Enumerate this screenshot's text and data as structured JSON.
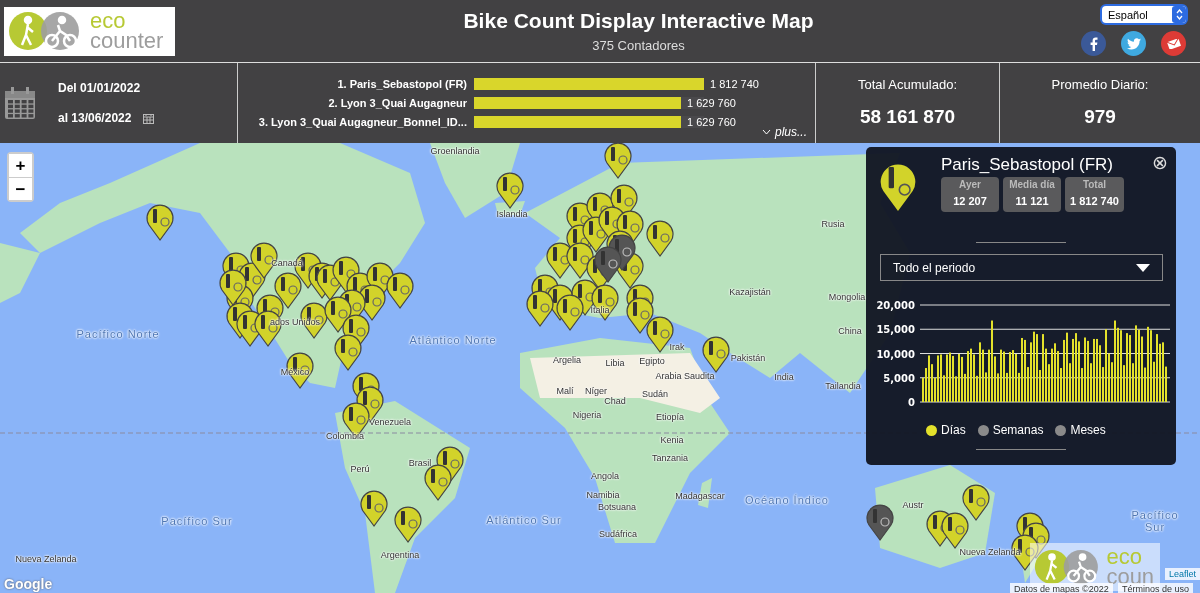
{
  "header": {
    "logo": {
      "line1": "eco",
      "line2": "counter"
    },
    "title": "Bike Count Display Interactive Map",
    "subtitle": "375 Contadores",
    "language": "Español"
  },
  "period": {
    "from": "Del 01/01/2022",
    "to": "al 13/06/2022"
  },
  "ranking": {
    "items": [
      {
        "label": "1. Paris_Sebastopol (FR)",
        "value": "1 812 740",
        "level": 1
      },
      {
        "label": "2. Lyon 3_Quai Augagneur",
        "value": "1 629 760",
        "level": 0.9
      },
      {
        "label": "3. Lyon 3_Quai Augagneur_Bonnel_ID...",
        "value": "1 629 760",
        "level": 0.9
      }
    ],
    "more": "plus..."
  },
  "totals": [
    {
      "label": "Total Acumulado:",
      "value": "58 161 870"
    },
    {
      "label": "Promedio Diario:",
      "value": "979"
    }
  ],
  "map": {
    "zoom_in": "+",
    "zoom_out": "−",
    "labels": [
      "Groenlandia",
      "Islandia",
      "Canadá",
      "ados Unidos",
      "Pacífico Norte",
      "Atlántico Norte",
      "México",
      "Venezuela",
      "Colombia",
      "Perú",
      "Brasil",
      "Argentina",
      "Pacífico Sur",
      "Atlántico Sur",
      "Nueva Zelanda",
      "Argelia",
      "Libia",
      "Egipto",
      "Malí",
      "Níger",
      "Sudán",
      "Chad",
      "Nigeria",
      "Etiopía",
      "Kenia",
      "Tanzania",
      "Angola",
      "Namibia",
      "Botsuana",
      "Sudáfrica",
      "Madagascar",
      "Océano Índico",
      "Italia",
      "Irak",
      "Arabia Saudita",
      "Pakistán",
      "India",
      "Mongolia",
      "China",
      "Kazajistán",
      "Rusia",
      "Tailandia",
      "Austr",
      "Pacífico Sur",
      "Nueva Zelanda"
    ],
    "overlay_logo": {
      "line1": "eco",
      "line2": "coun"
    },
    "attribution": "Leaflet",
    "map_data": "Datos de mapas ©2022",
    "terms": "Términos de uso",
    "google": "Google"
  },
  "popup": {
    "title": "Paris_Sebastopol (FR)",
    "close": "⊗",
    "stats": [
      {
        "label": "Ayer",
        "value": "12 207"
      },
      {
        "label": "Media día",
        "value": "11 121"
      },
      {
        "label": "Total",
        "value": "1 812 740"
      }
    ],
    "period": "Todo el periodo",
    "chart_data": {
      "type": "bar",
      "grid": true,
      "ylim": [
        0,
        20000
      ],
      "yticks": [
        {
          "value": 0,
          "label": "0"
        },
        {
          "value": 5000,
          "label": "5,000"
        },
        {
          "value": 10000,
          "label": "10,000"
        },
        {
          "value": 15000,
          "label": "15,000"
        },
        {
          "value": 20000,
          "label": "20,000"
        }
      ],
      "series": [
        {
          "name": "Días",
          "color": "#e3e12b",
          "values": [
            5000,
            7000,
            9600,
            7800,
            5000,
            9600,
            9800,
            5500,
            9800,
            10200,
            9500,
            5300,
            9900,
            9300,
            5800,
            10500,
            11000,
            9800,
            5400,
            12300,
            10800,
            6100,
            10800,
            16800,
            9400,
            5900,
            10800,
            10400,
            6000,
            10300,
            10700,
            9900,
            6000,
            13200,
            12800,
            7200,
            12300,
            14500,
            14000,
            6600,
            14000,
            11000,
            7800,
            11000,
            12100,
            10500,
            7000,
            12800,
            14300,
            8000,
            13000,
            14200,
            12500,
            7000,
            13300,
            12600,
            8000,
            13000,
            13000,
            11700,
            7200,
            15000,
            10000,
            8200,
            16800,
            15300,
            14800,
            7600,
            14200,
            13800,
            8000,
            15800,
            14900,
            13500,
            7100,
            15500,
            14800,
            8300,
            14000,
            12000,
            12300,
            7300
          ]
        }
      ]
    },
    "legend": [
      {
        "selected": true
      },
      {
        "label": "Semanas",
        "selected": false
      },
      {
        "label": "Meses",
        "selected": false
      }
    ]
  }
}
